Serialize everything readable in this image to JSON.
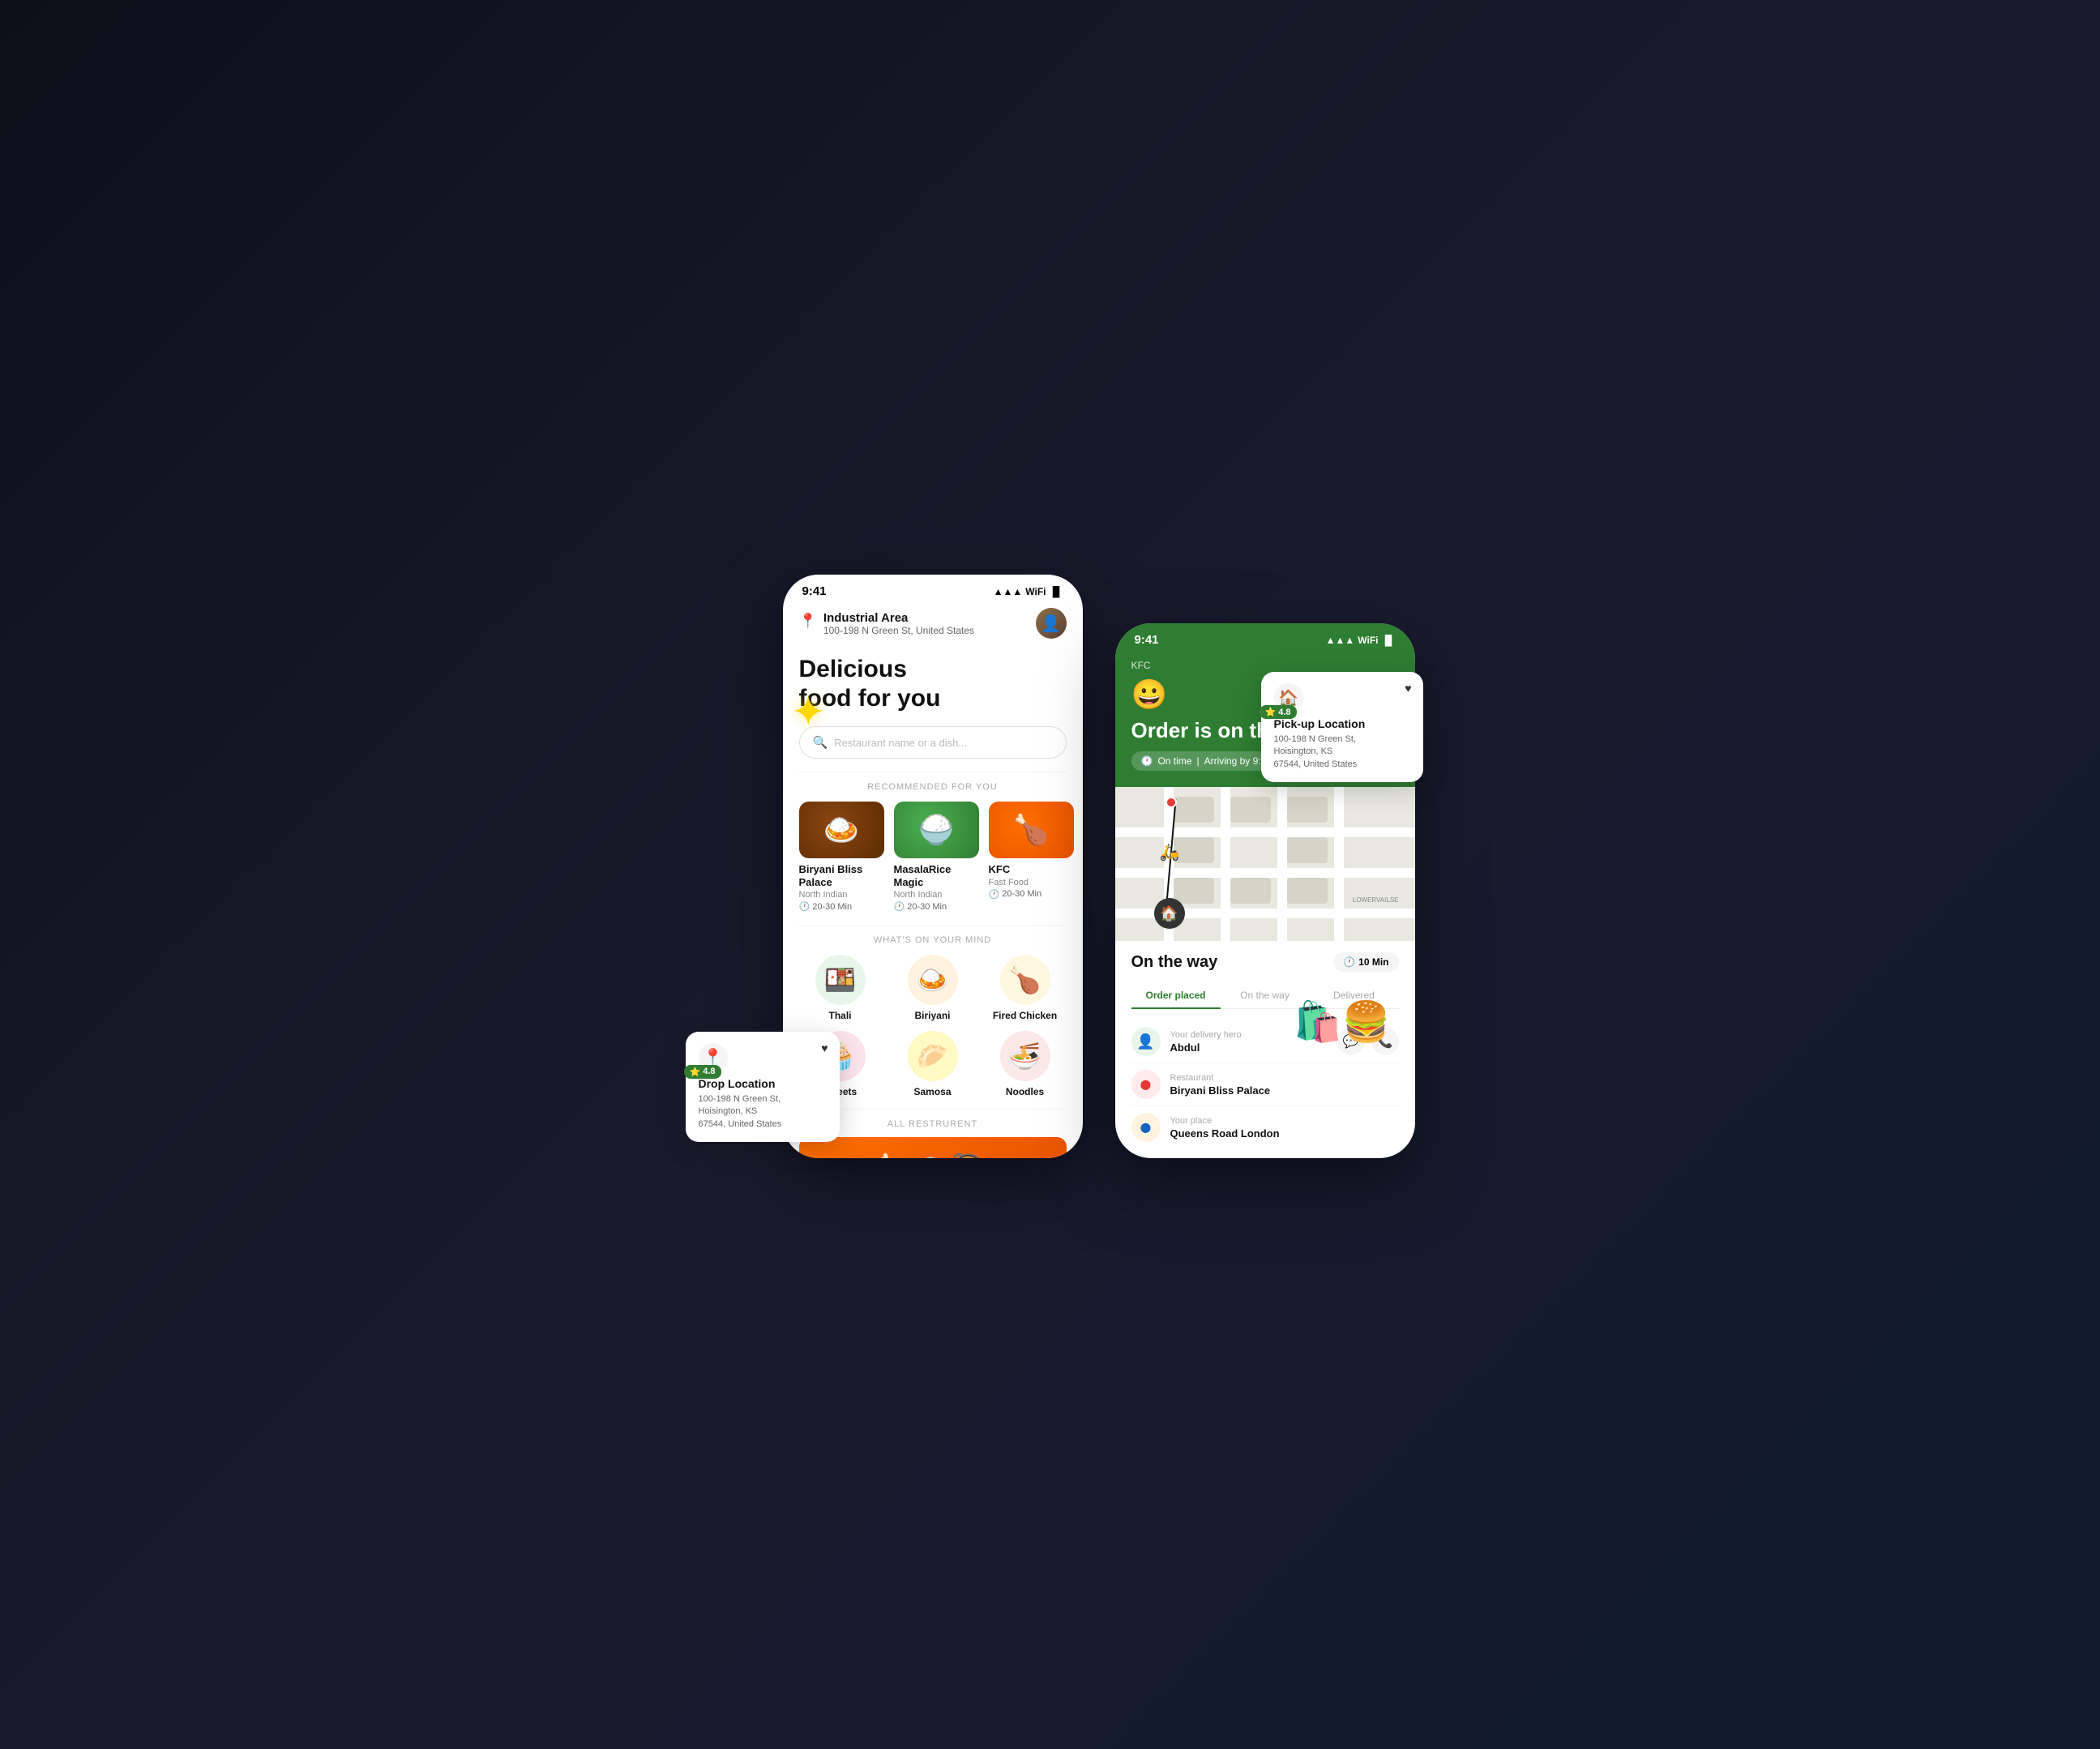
{
  "scene": {
    "decoration_star": "✦",
    "decoration_blob": ""
  },
  "phone_main": {
    "status_bar": {
      "time": "9:41",
      "signal": "▲▲▲",
      "wifi": "WiFi",
      "battery": "🔋"
    },
    "location": {
      "name": "Industrial Area",
      "address": "100-198 N Green St, United States"
    },
    "hero_title": "Delicious\nfood for you",
    "search_placeholder": "Restaurant name or a dish...",
    "sections": {
      "recommended_label": "RECOMMENDED FOR YOU",
      "whats_on_mind_label": "WHAT'S ON YOUR MIND",
      "all_restaurant_label": "ALL RESTRURENT"
    },
    "restaurants": [
      {
        "name": "Biryani Bliss Palace",
        "cuisine": "North Indian",
        "time": "20-30 Min",
        "emoji": "🍛"
      },
      {
        "name": "MasalaRice Magic",
        "cuisine": "North Indian",
        "time": "20-30 Min",
        "emoji": "🍚"
      },
      {
        "name": "KFC",
        "cuisine": "Fast Food",
        "time": "20-30 Min",
        "emoji": "🍗"
      }
    ],
    "food_categories": [
      {
        "name": "Thali",
        "emoji": "🍱"
      },
      {
        "name": "Biriyani",
        "emoji": "🍛"
      },
      {
        "name": "Fired Chicken",
        "emoji": "🍗"
      },
      {
        "name": "Sweets",
        "emoji": "🧁"
      },
      {
        "name": "Samosa",
        "emoji": "🥟"
      },
      {
        "name": "Noodles",
        "emoji": "🍜"
      }
    ]
  },
  "phone_order": {
    "status_bar": {
      "time": "9:41",
      "signal": "▲▲▲",
      "wifi": "WiFi",
      "battery": "🔋"
    },
    "kfc_label": "KFC",
    "emoji_face": "😀",
    "order_title": "Order is on the way",
    "on_time_text": "On time",
    "arriving_text": "Arriving by 9:57 AM",
    "on_the_way_title": "On the way",
    "time_badge": "10 Min",
    "tabs": [
      {
        "label": "Order placed",
        "active": true
      },
      {
        "label": "On the way",
        "active": false
      },
      {
        "label": "Delivered",
        "active": false
      }
    ],
    "delivery_rows": [
      {
        "label": "Your delivery hero",
        "value": "Abdul",
        "icon": "👤",
        "has_actions": true
      },
      {
        "label": "Restaurant",
        "value": "Biryani Bliss Palace",
        "icon": "🔴",
        "has_actions": false
      },
      {
        "label": "Your place",
        "value": "Queens Road London",
        "icon": "🔵",
        "has_actions": false
      }
    ]
  },
  "location_cards": {
    "drop": {
      "title": "Drop Location",
      "address": "100-198 N Green St,\nHoisington, KS\n67544, United States",
      "rating": "4.8"
    },
    "pickup": {
      "title": "Pick-up Location",
      "address": "100-198 N Green St,\nHoisington, KS\n67544, United States",
      "rating": "4.8"
    }
  }
}
